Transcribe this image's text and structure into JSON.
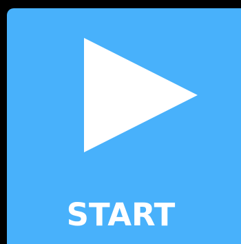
{
  "start_button": {
    "label": "START",
    "icon": "play-icon",
    "background_color": "#48b1fb",
    "foreground_color": "#ffffff"
  },
  "page": {
    "background_color": "#000000"
  }
}
